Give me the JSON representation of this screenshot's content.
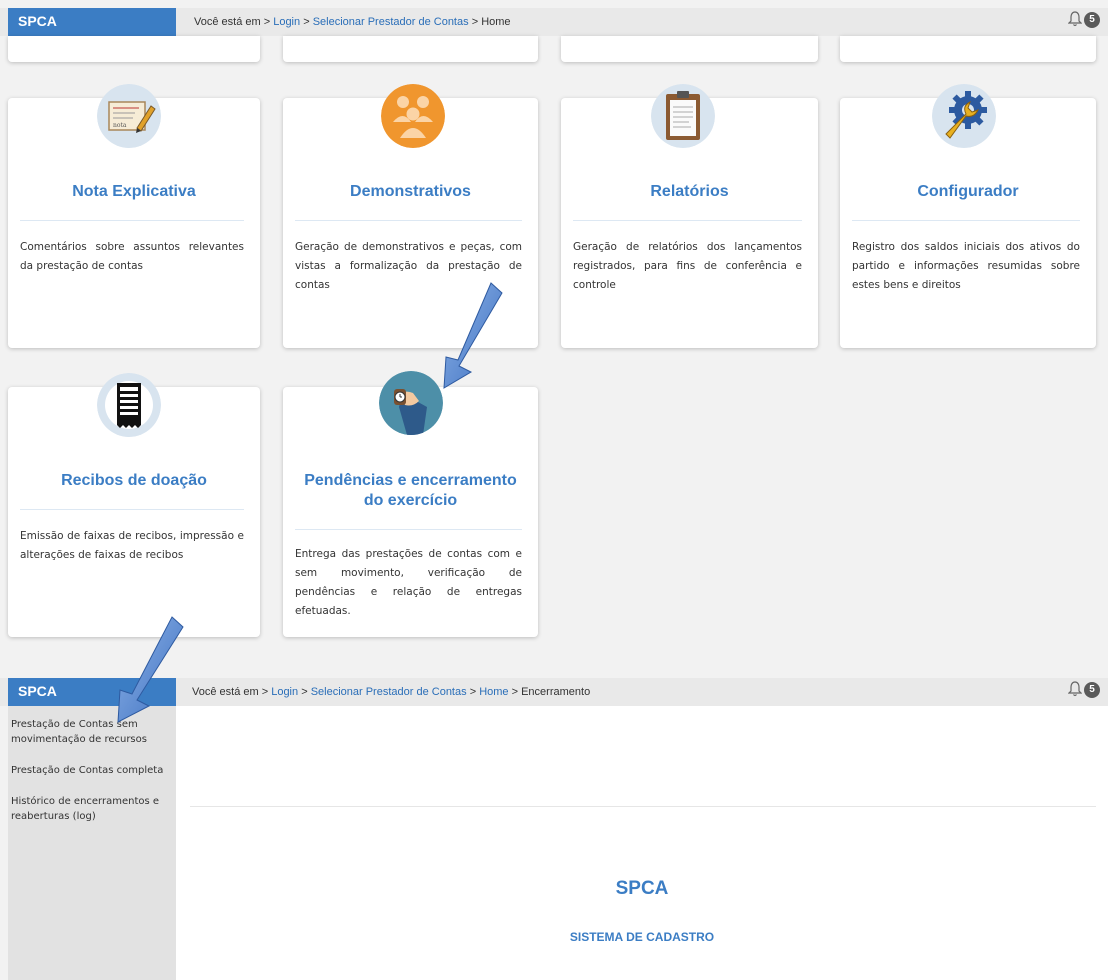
{
  "top": {
    "brand": "SPCA",
    "breadcrumb_prefix": "Você está em >",
    "breadcrumb_login": "Login",
    "breadcrumb_sep1": ">",
    "breadcrumb_selecionar": "Selecionar Prestador de Contas",
    "breadcrumb_sep2": ">",
    "breadcrumb_home": "Home",
    "badge_count": "5"
  },
  "cards": [
    {
      "title": "Nota Explicativa",
      "icon": "nota-explicativa-icon",
      "desc": "Comentários sobre assuntos relevantes da prestação de contas"
    },
    {
      "title": "Demonstrativos",
      "icon": "people-icon",
      "desc": "Geração de demonstrativos e peças, com vistas a formalização da prestação de contas"
    },
    {
      "title": "Relatórios",
      "icon": "clipboard-icon",
      "desc": "Geração de relatórios dos lançamentos registrados, para fins de conferência e controle"
    },
    {
      "title": "Configurador",
      "icon": "gear-wrench-icon",
      "desc": "Registro dos saldos iniciais dos ativos do partido e informações resumidas sobre estes bens e direitos"
    },
    {
      "title": "Recibos de doação",
      "icon": "receipt-icon",
      "desc": "Emissão de faixas de recibos, impressão e alterações de faixas de recibos"
    },
    {
      "title": "Pendências e encerramento do exercício",
      "icon": "watch-icon",
      "desc": "Entrega das prestações de contas com e sem movimento, verificação de pendências e relação de entregas efetuadas."
    }
  ],
  "bottom": {
    "brand": "SPCA",
    "breadcrumb_prefix": "Você está em >",
    "breadcrumb_login": "Login",
    "breadcrumb_sep1": ">",
    "breadcrumb_selecionar": "Selecionar Prestador de Contas",
    "breadcrumb_sep2": ">",
    "breadcrumb_home": "Home",
    "breadcrumb_sep3": ">",
    "breadcrumb_current": "Encerramento",
    "badge_count": "5",
    "menu": [
      "Prestação de Contas sem movimentação de recursos",
      "Prestação de Contas completa",
      "Histórico de encerramentos e reaberturas (log)"
    ],
    "main_title": "SPCA",
    "main_subtitle": "SISTEMA DE CADASTRO"
  },
  "colors": {
    "accent": "#3b7dc4",
    "arrow": "#5b8ed6"
  }
}
